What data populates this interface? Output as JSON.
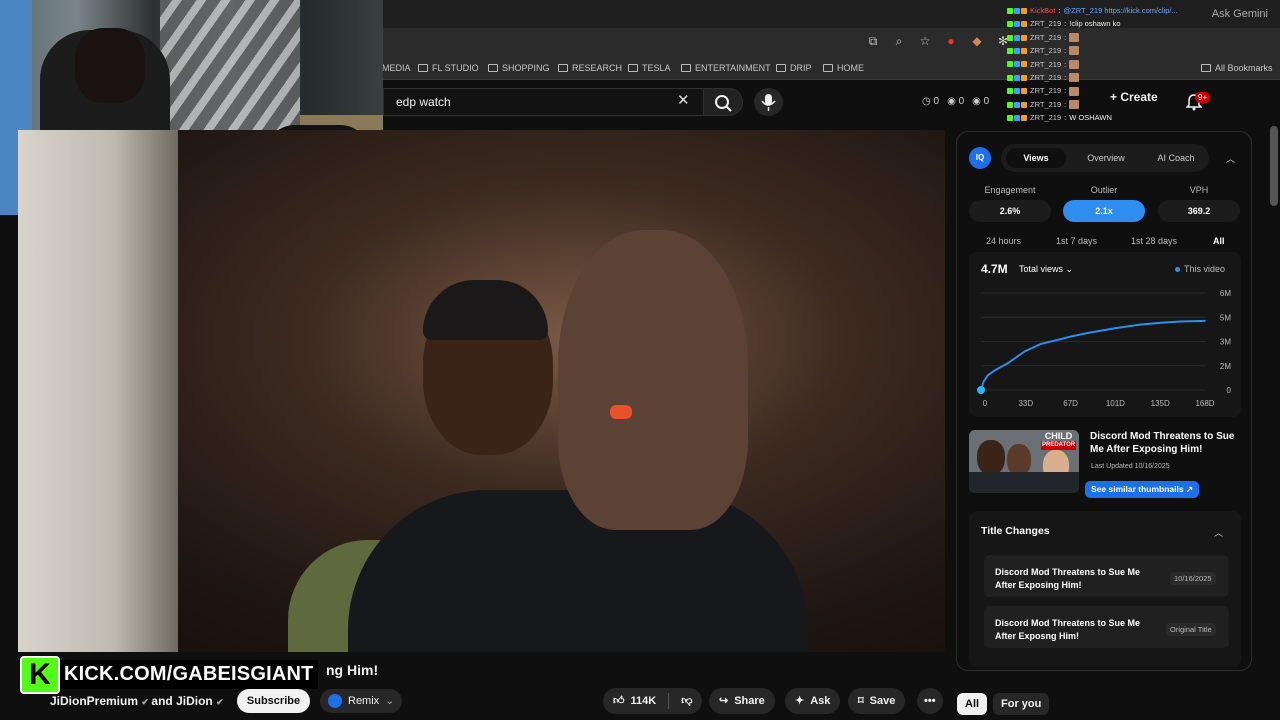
{
  "browser": {
    "ask_gemini": "Ask Gemini",
    "bookmarks": [
      "MEDIA",
      "FL STUDIO",
      "SHOPPING",
      "RESEARCH",
      "TESLA",
      "ENTERTAINMENT",
      "DRIP",
      "HOME"
    ],
    "all_bookmarks": "All Bookmarks"
  },
  "youtube": {
    "search_value": "edp watch",
    "stats": [
      "0",
      "0",
      "0"
    ],
    "create_label": "Create",
    "notification_badge": "9+"
  },
  "chat": [
    {
      "user": "KickBot",
      "is_bot": true,
      "message": "@ZRT_219 https://kick.com/clip/..."
    },
    {
      "user": "ZRT_219",
      "is_bot": false,
      "message": "!clip oshawn ko"
    },
    {
      "user": "ZRT_219",
      "is_bot": false,
      "message": "",
      "emote": true
    },
    {
      "user": "ZRT_219",
      "is_bot": false,
      "message": "",
      "emote": true
    },
    {
      "user": "ZRT_219",
      "is_bot": false,
      "message": "",
      "emote": true
    },
    {
      "user": "ZRT_219",
      "is_bot": false,
      "message": "",
      "emote": true
    },
    {
      "user": "ZRT_219",
      "is_bot": false,
      "message": "",
      "emote": true
    },
    {
      "user": "ZRT_219",
      "is_bot": false,
      "message": "",
      "emote": true
    },
    {
      "user": "ZRT_219",
      "is_bot": false,
      "message": "W OSHAWN"
    }
  ],
  "overlay": {
    "kick_logo": "K",
    "kick_url": "KICK.COM/GABEISGIANT"
  },
  "video": {
    "title_visible_tail": "ng Him!",
    "channel": "JiDionPremium",
    "channel_and": "and JiDion",
    "subscribe": "Subscribe",
    "remix": "Remix",
    "likes": "114K",
    "share": "Share",
    "ask": "Ask",
    "save": "Save",
    "chips": [
      "All",
      "For you"
    ]
  },
  "vidiq": {
    "logo": "IQ",
    "tabs": [
      "Views",
      "Overview",
      "AI Coach"
    ],
    "active_tab": "Views",
    "metrics": [
      {
        "label": "Engagement",
        "value": "2.6%"
      },
      {
        "label": "Outlier",
        "value": "2.1x"
      },
      {
        "label": "VPH",
        "value": "369.2"
      }
    ],
    "ranges": [
      "24 hours",
      "1st 7 days",
      "1st 28 days",
      "All"
    ],
    "active_range": "All",
    "total": "4.7M",
    "total_selector": "Total views",
    "legend": "This video",
    "similar": {
      "title": "Discord Mod Threatens to Sue Me After Exposing Him!",
      "updated": "Last Updated 10/16/2025",
      "button": "See similar thumbnails",
      "thumb_text_1": "CHILD",
      "thumb_text_2": "PREDATOR"
    },
    "title_changes": {
      "heading": "Title Changes",
      "items": [
        {
          "title": "Discord Mod Threatens to Sue Me After Exposing Him!",
          "tag": "10/16/2025"
        },
        {
          "title": "Discord Mod Threatens to Sue Me After Exposng Him!",
          "tag": "Original Title"
        }
      ]
    }
  },
  "chart_data": {
    "type": "line",
    "title": "",
    "series": [
      {
        "name": "This video",
        "x": [
          0,
          2,
          5,
          10,
          20,
          33,
          45,
          60,
          67,
          80,
          101,
          120,
          135,
          150,
          168
        ],
        "y": [
          0.0,
          0.7,
          1.2,
          1.6,
          2.1,
          2.6,
          2.9,
          3.2,
          3.4,
          3.7,
          4.1,
          4.4,
          4.55,
          4.65,
          4.7
        ]
      }
    ],
    "x_ticks": [
      "0",
      "33D",
      "67D",
      "101D",
      "135D",
      "168D"
    ],
    "y_ticks": [
      "0",
      "2M",
      "3M",
      "5M",
      "6M"
    ],
    "xlim": [
      0,
      168
    ],
    "ylim": [
      0,
      6
    ],
    "grid": true,
    "legend": "top-right"
  }
}
